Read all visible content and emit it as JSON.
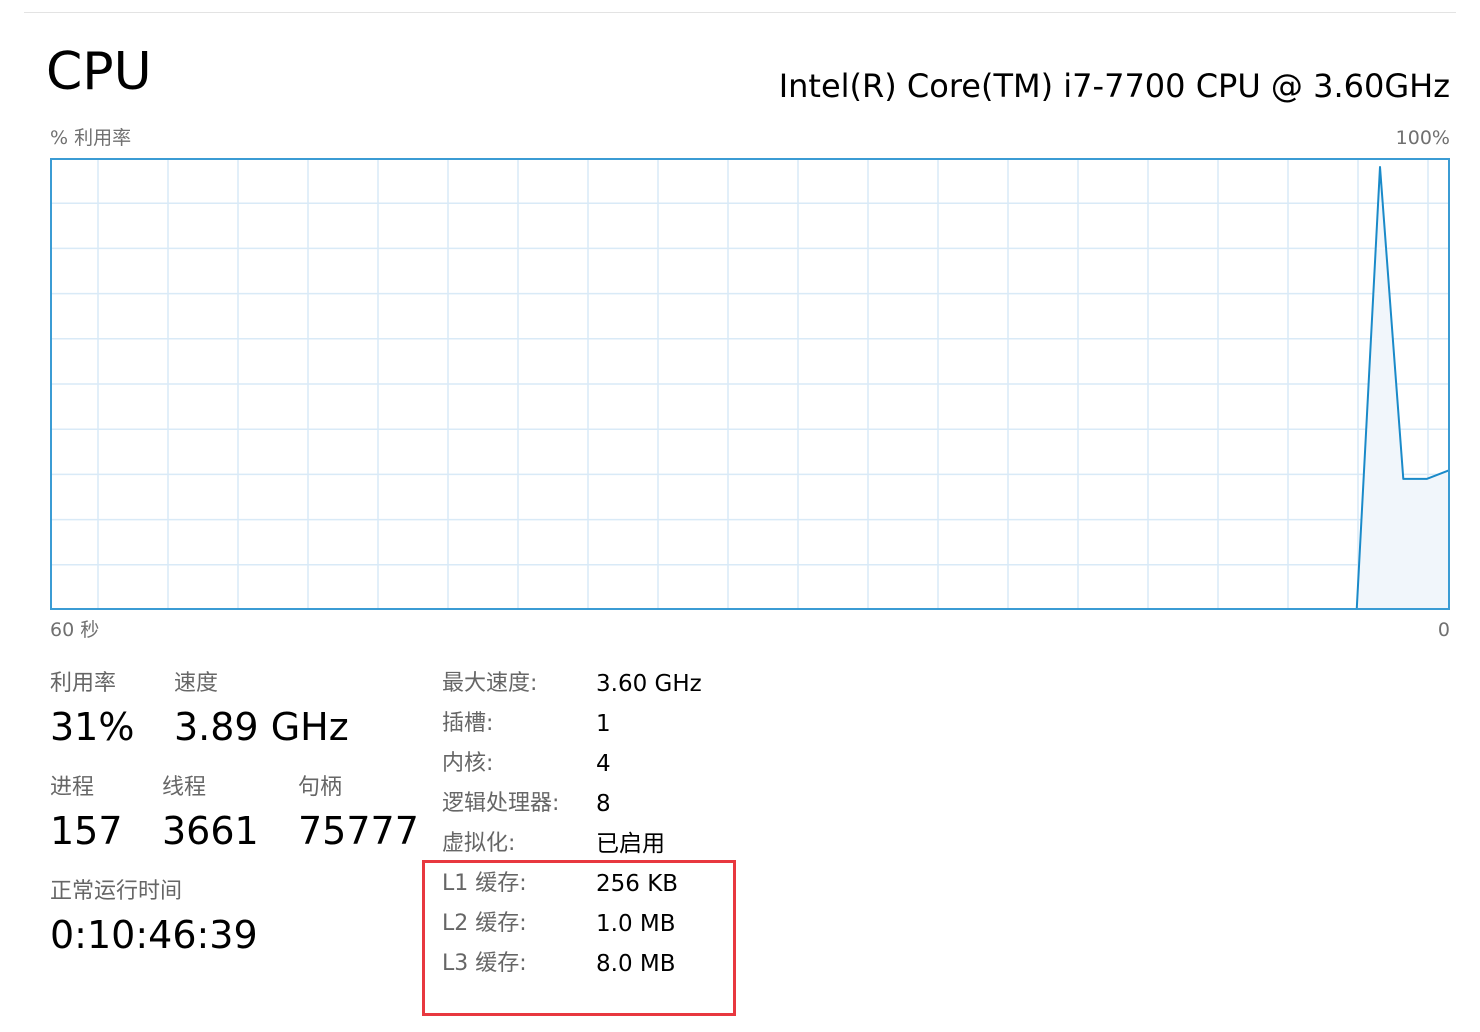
{
  "header": {
    "title": "CPU",
    "cpu_model": "Intel(R) Core(TM) i7-7700 CPU @ 3.60GHz"
  },
  "graph": {
    "y_label": "% 利用率",
    "y_max_label": "100%",
    "x_start_label": "60 秒",
    "x_end_label": "0",
    "colors": {
      "line": "#1a8ac9",
      "fill": "#f1f6fb",
      "grid": "#d9eaf7",
      "border": "#3b9cd4"
    },
    "chart_data": {
      "type": "area",
      "x": [
        60,
        59,
        58,
        57,
        56,
        55,
        54,
        53,
        52,
        51,
        50,
        49,
        48,
        47,
        46,
        45,
        44,
        43,
        42,
        41,
        40,
        39,
        38,
        37,
        36,
        35,
        34,
        33,
        32,
        31,
        30,
        29,
        28,
        27,
        26,
        25,
        24,
        23,
        22,
        21,
        20,
        19,
        18,
        17,
        16,
        15,
        14,
        13,
        12,
        11,
        10,
        9,
        8,
        7,
        6,
        5,
        4,
        3,
        2,
        1,
        0
      ],
      "series": [
        {
          "values": [
            0,
            0,
            0,
            0,
            0,
            0,
            0,
            0,
            0,
            0,
            0,
            0,
            0,
            0,
            0,
            0,
            0,
            0,
            0,
            0,
            0,
            0,
            0,
            0,
            0,
            0,
            0,
            0,
            0,
            0,
            0,
            0,
            0,
            0,
            0,
            0,
            0,
            0,
            0,
            0,
            0,
            0,
            0,
            0,
            0,
            0,
            0,
            0,
            0,
            0,
            0,
            0,
            0,
            0,
            0,
            0,
            0,
            98,
            29,
            29,
            31
          ]
        }
      ],
      "ylim": [
        0,
        100
      ],
      "grid": true
    }
  },
  "stats": {
    "utilization": {
      "label": "利用率",
      "value": "31%"
    },
    "speed": {
      "label": "速度",
      "value": "3.89 GHz"
    },
    "processes": {
      "label": "进程",
      "value": "157"
    },
    "threads": {
      "label": "线程",
      "value": "3661"
    },
    "handles": {
      "label": "句柄",
      "value": "75777"
    },
    "uptime": {
      "label": "正常运行时间",
      "value": "0:10:46:39"
    }
  },
  "specs": [
    {
      "label": "最大速度:",
      "value": "3.60 GHz"
    },
    {
      "label": "插槽:",
      "value": "1"
    },
    {
      "label": "内核:",
      "value": "4"
    },
    {
      "label": "逻辑处理器:",
      "value": "8"
    },
    {
      "label": "虚拟化:",
      "value": "已启用"
    },
    {
      "label": "L1 缓存:",
      "value": "256 KB"
    },
    {
      "label": "L2 缓存:",
      "value": "1.0 MB"
    },
    {
      "label": "L3 缓存:",
      "value": "8.0 MB"
    }
  ],
  "highlight": {
    "color": "#e8383f"
  }
}
